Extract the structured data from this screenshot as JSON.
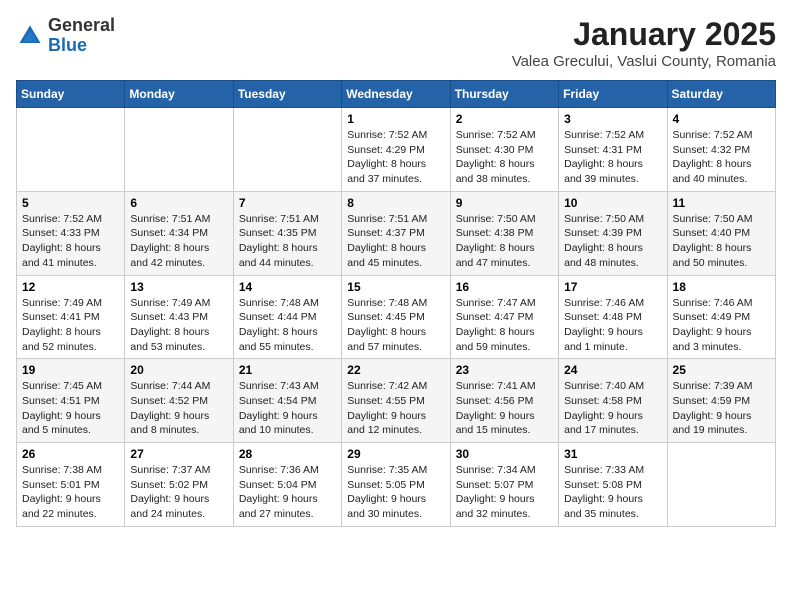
{
  "logo": {
    "general": "General",
    "blue": "Blue"
  },
  "header": {
    "month": "January 2025",
    "location": "Valea Grecului, Vaslui County, Romania"
  },
  "weekdays": [
    "Sunday",
    "Monday",
    "Tuesday",
    "Wednesday",
    "Thursday",
    "Friday",
    "Saturday"
  ],
  "weeks": [
    [
      {
        "day": "",
        "info": ""
      },
      {
        "day": "",
        "info": ""
      },
      {
        "day": "",
        "info": ""
      },
      {
        "day": "1",
        "info": "Sunrise: 7:52 AM\nSunset: 4:29 PM\nDaylight: 8 hours and 37 minutes."
      },
      {
        "day": "2",
        "info": "Sunrise: 7:52 AM\nSunset: 4:30 PM\nDaylight: 8 hours and 38 minutes."
      },
      {
        "day": "3",
        "info": "Sunrise: 7:52 AM\nSunset: 4:31 PM\nDaylight: 8 hours and 39 minutes."
      },
      {
        "day": "4",
        "info": "Sunrise: 7:52 AM\nSunset: 4:32 PM\nDaylight: 8 hours and 40 minutes."
      }
    ],
    [
      {
        "day": "5",
        "info": "Sunrise: 7:52 AM\nSunset: 4:33 PM\nDaylight: 8 hours and 41 minutes."
      },
      {
        "day": "6",
        "info": "Sunrise: 7:51 AM\nSunset: 4:34 PM\nDaylight: 8 hours and 42 minutes."
      },
      {
        "day": "7",
        "info": "Sunrise: 7:51 AM\nSunset: 4:35 PM\nDaylight: 8 hours and 44 minutes."
      },
      {
        "day": "8",
        "info": "Sunrise: 7:51 AM\nSunset: 4:37 PM\nDaylight: 8 hours and 45 minutes."
      },
      {
        "day": "9",
        "info": "Sunrise: 7:50 AM\nSunset: 4:38 PM\nDaylight: 8 hours and 47 minutes."
      },
      {
        "day": "10",
        "info": "Sunrise: 7:50 AM\nSunset: 4:39 PM\nDaylight: 8 hours and 48 minutes."
      },
      {
        "day": "11",
        "info": "Sunrise: 7:50 AM\nSunset: 4:40 PM\nDaylight: 8 hours and 50 minutes."
      }
    ],
    [
      {
        "day": "12",
        "info": "Sunrise: 7:49 AM\nSunset: 4:41 PM\nDaylight: 8 hours and 52 minutes."
      },
      {
        "day": "13",
        "info": "Sunrise: 7:49 AM\nSunset: 4:43 PM\nDaylight: 8 hours and 53 minutes."
      },
      {
        "day": "14",
        "info": "Sunrise: 7:48 AM\nSunset: 4:44 PM\nDaylight: 8 hours and 55 minutes."
      },
      {
        "day": "15",
        "info": "Sunrise: 7:48 AM\nSunset: 4:45 PM\nDaylight: 8 hours and 57 minutes."
      },
      {
        "day": "16",
        "info": "Sunrise: 7:47 AM\nSunset: 4:47 PM\nDaylight: 8 hours and 59 minutes."
      },
      {
        "day": "17",
        "info": "Sunrise: 7:46 AM\nSunset: 4:48 PM\nDaylight: 9 hours and 1 minute."
      },
      {
        "day": "18",
        "info": "Sunrise: 7:46 AM\nSunset: 4:49 PM\nDaylight: 9 hours and 3 minutes."
      }
    ],
    [
      {
        "day": "19",
        "info": "Sunrise: 7:45 AM\nSunset: 4:51 PM\nDaylight: 9 hours and 5 minutes."
      },
      {
        "day": "20",
        "info": "Sunrise: 7:44 AM\nSunset: 4:52 PM\nDaylight: 9 hours and 8 minutes."
      },
      {
        "day": "21",
        "info": "Sunrise: 7:43 AM\nSunset: 4:54 PM\nDaylight: 9 hours and 10 minutes."
      },
      {
        "day": "22",
        "info": "Sunrise: 7:42 AM\nSunset: 4:55 PM\nDaylight: 9 hours and 12 minutes."
      },
      {
        "day": "23",
        "info": "Sunrise: 7:41 AM\nSunset: 4:56 PM\nDaylight: 9 hours and 15 minutes."
      },
      {
        "day": "24",
        "info": "Sunrise: 7:40 AM\nSunset: 4:58 PM\nDaylight: 9 hours and 17 minutes."
      },
      {
        "day": "25",
        "info": "Sunrise: 7:39 AM\nSunset: 4:59 PM\nDaylight: 9 hours and 19 minutes."
      }
    ],
    [
      {
        "day": "26",
        "info": "Sunrise: 7:38 AM\nSunset: 5:01 PM\nDaylight: 9 hours and 22 minutes."
      },
      {
        "day": "27",
        "info": "Sunrise: 7:37 AM\nSunset: 5:02 PM\nDaylight: 9 hours and 24 minutes."
      },
      {
        "day": "28",
        "info": "Sunrise: 7:36 AM\nSunset: 5:04 PM\nDaylight: 9 hours and 27 minutes."
      },
      {
        "day": "29",
        "info": "Sunrise: 7:35 AM\nSunset: 5:05 PM\nDaylight: 9 hours and 30 minutes."
      },
      {
        "day": "30",
        "info": "Sunrise: 7:34 AM\nSunset: 5:07 PM\nDaylight: 9 hours and 32 minutes."
      },
      {
        "day": "31",
        "info": "Sunrise: 7:33 AM\nSunset: 5:08 PM\nDaylight: 9 hours and 35 minutes."
      },
      {
        "day": "",
        "info": ""
      }
    ]
  ]
}
